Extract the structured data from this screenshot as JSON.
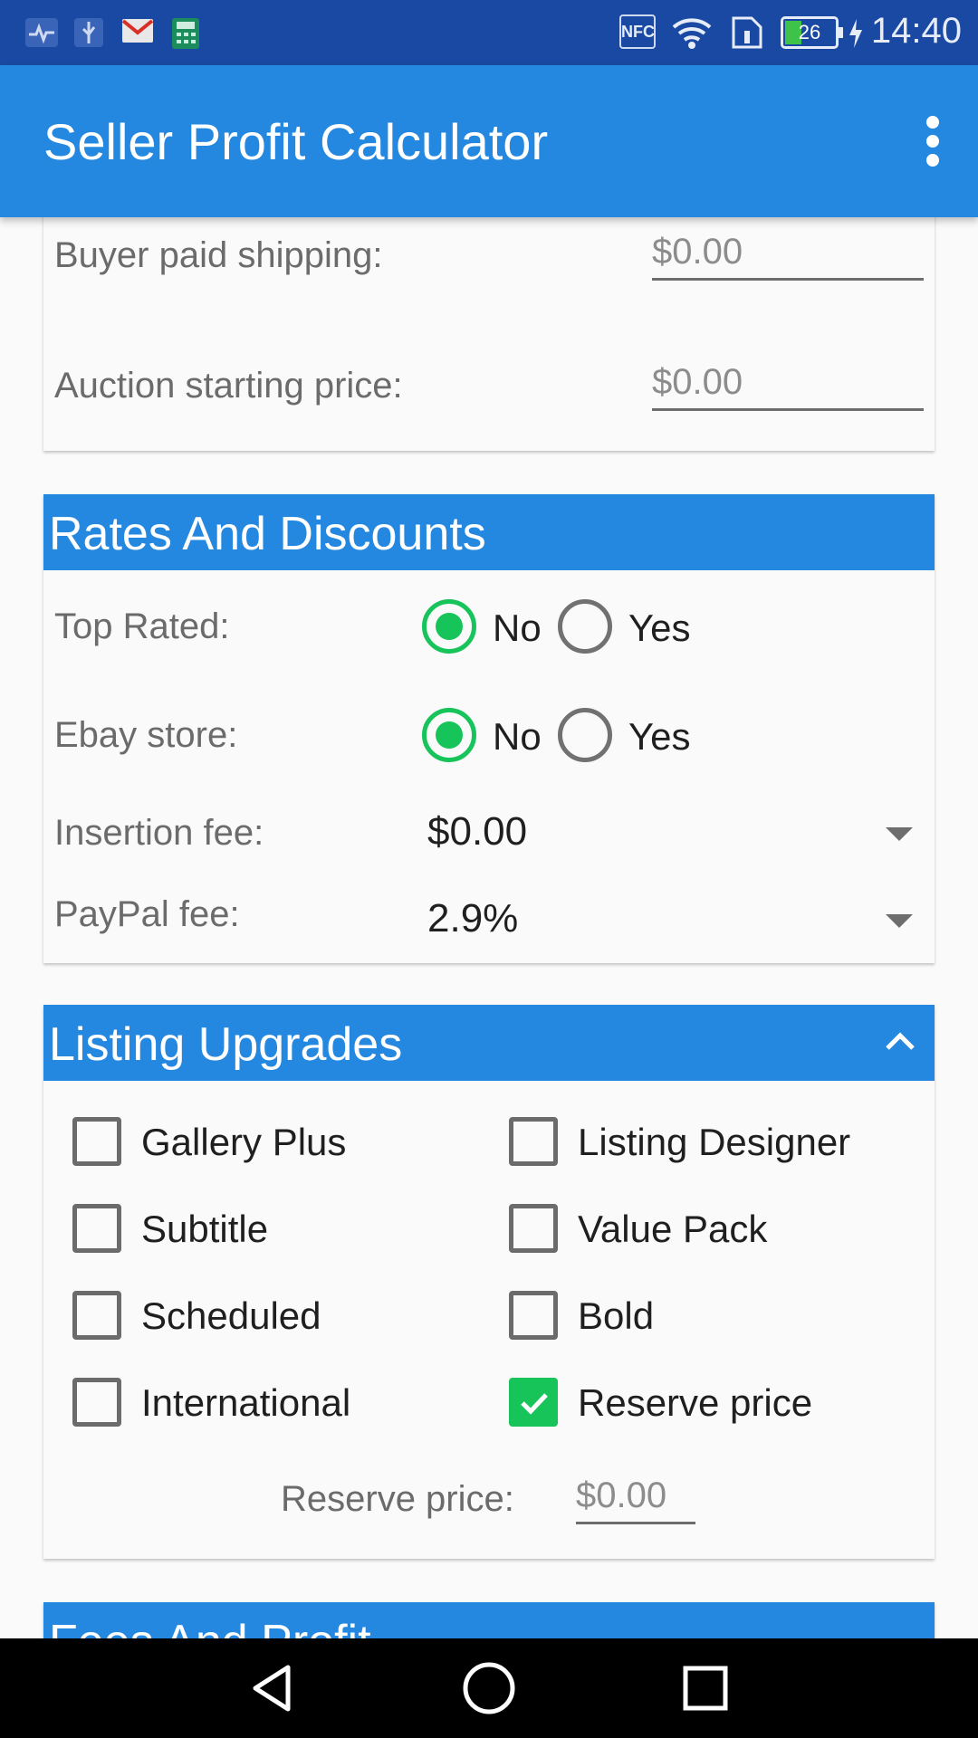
{
  "status_bar": {
    "icons": [
      "health-app-icon",
      "usb-icon",
      "gmail-icon",
      "calculator-icon",
      "nfc-icon",
      "wifi-icon",
      "sim-icon",
      "battery-icon",
      "charging-icon"
    ],
    "nfc_label": "NFC",
    "battery": "26",
    "time": "14:40"
  },
  "app_bar": {
    "title": "Seller Profit Calculator",
    "menu_icon": "more-vert-icon"
  },
  "shipping_card": {
    "buyer_paid_shipping_label": "Buyer paid shipping:",
    "buyer_paid_shipping_value": "$0.00",
    "auction_start_label": "Auction starting price:",
    "auction_start_value": "$0.00"
  },
  "rates": {
    "header": "Rates And Discounts",
    "top_rated_label": "Top Rated:",
    "top_rated_options": [
      "No",
      "Yes"
    ],
    "top_rated_selected": "No",
    "ebay_store_label": "Ebay store:",
    "ebay_store_options": [
      "No",
      "Yes"
    ],
    "ebay_store_selected": "No",
    "insertion_fee_label": "Insertion fee:",
    "insertion_fee_value": "$0.00",
    "paypal_fee_label": "PayPal fee:",
    "paypal_fee_value": "2.9%"
  },
  "upgrades": {
    "header": "Listing Upgrades",
    "collapse_icon": "chevron-up-icon",
    "items": [
      {
        "label": "Gallery Plus",
        "checked": false
      },
      {
        "label": "Listing Designer",
        "checked": false
      },
      {
        "label": "Subtitle",
        "checked": false
      },
      {
        "label": "Value Pack",
        "checked": false
      },
      {
        "label": "Scheduled",
        "checked": false
      },
      {
        "label": "Bold",
        "checked": false
      },
      {
        "label": "International",
        "checked": false
      },
      {
        "label": "Reserve price",
        "checked": true
      }
    ],
    "reserve_price_label": "Reserve price:",
    "reserve_price_value": "$0.00"
  },
  "fees_card": {
    "header": "Fees And Profit"
  },
  "colors": {
    "status_bar": "#1a49a3",
    "primary": "#2488e0",
    "accent_green": "#17c45a",
    "background": "#fafafa"
  }
}
